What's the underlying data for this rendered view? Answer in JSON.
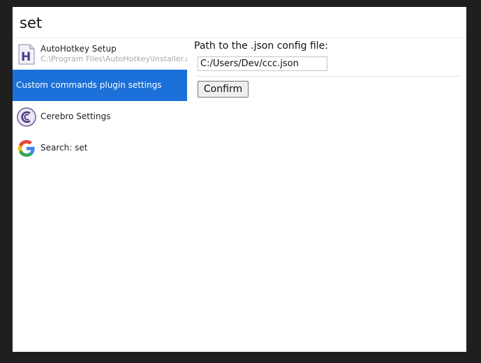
{
  "search": {
    "value": "set"
  },
  "results": {
    "items": [
      {
        "title": "AutoHotkey Setup",
        "subtitle": "C:\\Program Files\\AutoHotkey\\Installer.ahk",
        "icon": "autohotkey-icon"
      },
      {
        "title": "Custom commands plugin settings",
        "selected": true
      },
      {
        "title": "Cerebro Settings",
        "icon": "cerebro-icon"
      },
      {
        "title": "Search: set",
        "icon": "google-icon"
      }
    ]
  },
  "preview": {
    "label": "Path to the .json config file:",
    "path_value": "C:/Users/Dev/ccc.json",
    "confirm_label": "Confirm"
  },
  "colors": {
    "selected_bg": "#1b70d9",
    "window_bg": "#ffffff",
    "frame_bg": "#1f1f1f"
  }
}
